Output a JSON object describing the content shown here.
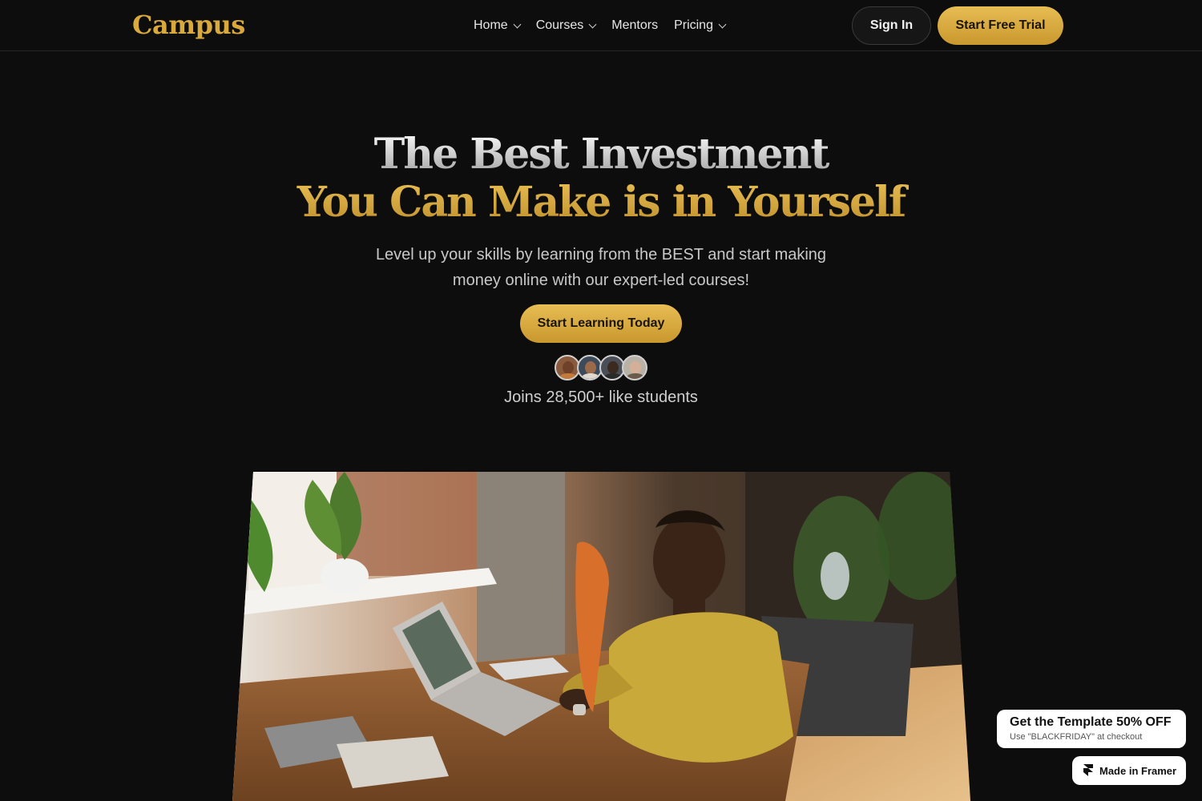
{
  "nav": {
    "logo": "Campus",
    "items": [
      {
        "label": "Home",
        "has_dropdown": true
      },
      {
        "label": "Courses",
        "has_dropdown": true
      },
      {
        "label": "Mentors",
        "has_dropdown": false
      },
      {
        "label": "Pricing",
        "has_dropdown": true
      }
    ],
    "sign_in": "Sign In",
    "start_trial": "Start Free Trial"
  },
  "hero": {
    "title_line1": "The Best Investment",
    "title_line2": "You Can Make is in Yourself",
    "subtitle": "Level up your skills by learning from the BEST and start making money online with our expert-led courses!",
    "cta": "Start Learning Today",
    "social_proof": "Joins 28,500+ like students"
  },
  "badges": {
    "promo_title": "Get the Template 50% OFF",
    "promo_sub": "Use \"BLACKFRIDAY\" at checkout",
    "framer": "Made in Framer"
  },
  "colors": {
    "accent": "#d9a93c",
    "background": "#0d0d0d"
  },
  "icons": [
    "chevron-down-icon",
    "framer-logo-icon",
    "student-avatar"
  ]
}
